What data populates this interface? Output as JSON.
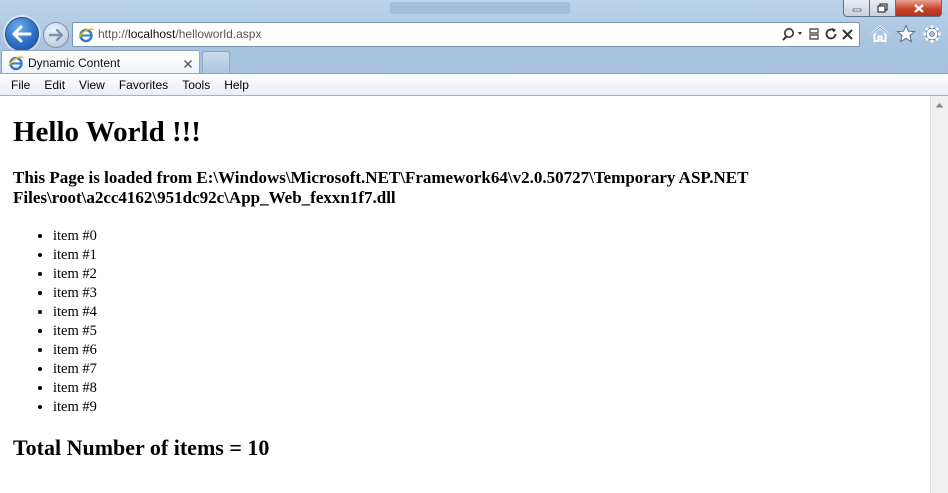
{
  "browser": {
    "address": {
      "scheme": "http://",
      "host": "localhost",
      "path": "/helloworld.aspx"
    },
    "tab": {
      "title": "Dynamic Content"
    },
    "menu": [
      "File",
      "Edit",
      "View",
      "Favorites",
      "Tools",
      "Help"
    ],
    "icons": {
      "back": "back-arrow-icon",
      "forward": "forward-arrow-icon",
      "page": "ie-page-icon",
      "search": "search-icon",
      "compat": "compatibility-view-icon",
      "refresh": "refresh-icon",
      "stop": "stop-icon",
      "home": "home-icon",
      "favorites": "favorites-star-icon",
      "tools": "tools-gear-icon"
    },
    "colors": {
      "chrome": "#a9c4e0",
      "close_button": "#c7442d"
    }
  },
  "page": {
    "heading": "Hello World !!!",
    "loaded_from": "This Page is loaded from E:\\Windows\\Microsoft.NET\\Framework64\\v2.0.50727\\Temporary ASP.NET Files\\root\\a2cc4162\\951dc92c\\App_Web_fexxn1f7.dll",
    "items": [
      "item #0",
      "item #1",
      "item #2",
      "item #3",
      "item #4",
      "item #5",
      "item #6",
      "item #7",
      "item #8",
      "item #9"
    ],
    "total": "Total Number of items = 10"
  }
}
